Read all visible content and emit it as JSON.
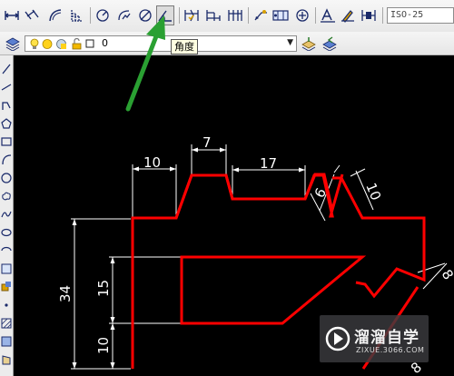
{
  "toolbar_dim": {
    "buttons": [
      {
        "name": "linear-dimension",
        "icon": "linear-dim-icon"
      },
      {
        "name": "aligned-dimension",
        "icon": "aligned-dim-icon"
      },
      {
        "name": "arc-length-dimension",
        "icon": "arc-length-icon"
      },
      {
        "name": "ordinate-dimension",
        "icon": "ordinate-dim-icon"
      },
      {
        "name": "radius-dimension",
        "icon": "radius-dim-icon"
      },
      {
        "name": "jogged-dimension",
        "icon": "jogged-dim-icon"
      },
      {
        "name": "diameter-dimension",
        "icon": "diameter-dim-icon"
      },
      {
        "name": "angular-dimension",
        "icon": "angular-dim-icon",
        "active": true
      },
      {
        "name": "quick-dimension",
        "icon": "quick-dim-icon"
      },
      {
        "name": "baseline-dimension",
        "icon": "baseline-dim-icon"
      },
      {
        "name": "continue-dimension",
        "icon": "continue-dim-icon"
      },
      {
        "name": "quick-leader",
        "icon": "leader-icon"
      },
      {
        "name": "tolerance",
        "icon": "tolerance-icon"
      },
      {
        "name": "center-mark",
        "icon": "center-mark-icon"
      },
      {
        "name": "dimension-edit",
        "icon": "dim-edit-icon"
      },
      {
        "name": "dimension-text-edit",
        "icon": "dim-text-edit-icon"
      },
      {
        "name": "dimension-update",
        "icon": "dim-update-icon"
      }
    ],
    "dim_style_value": "ISO-25"
  },
  "toolbar_layers": {
    "current_layer": "0",
    "tooltip": "角度"
  },
  "drawing": {
    "outline_color": "#ff0000",
    "dimensions": {
      "top_left_width": "10",
      "tooth_width": "7",
      "slot_width": "17",
      "small_step": "6",
      "right_tooth": "10",
      "overall_height": "34",
      "window_height": "15",
      "bottom_height": "10",
      "right_edge": "8",
      "corner": "8"
    }
  },
  "watermark": {
    "title": "溜溜自学",
    "subtitle": "ZIXUE.3066.COM"
  },
  "colors": {
    "annotation_arrow": "#2aa032",
    "canvas_bg": "#000000",
    "dimension_lines": "#ffffff"
  }
}
